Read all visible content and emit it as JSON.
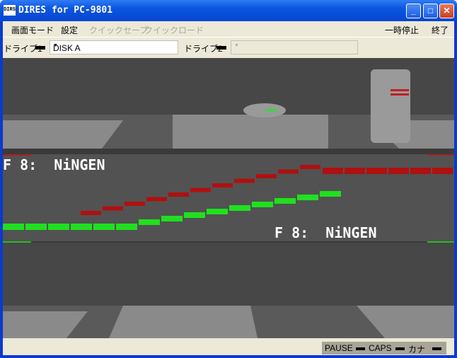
{
  "window": {
    "title": "DIRES for PC-9801",
    "icon_text": "DIRES"
  },
  "menu": {
    "items": [
      {
        "label": "画面モード",
        "enabled": true
      },
      {
        "label": "設定",
        "enabled": true
      },
      {
        "label": "クイックセーブ",
        "enabled": false
      },
      {
        "label": "クイックロード",
        "enabled": false
      }
    ],
    "pause": "一時停止",
    "exit": "終了"
  },
  "toolbar": {
    "drive1_label": "ドライブ1",
    "drive1_value": "DISK A",
    "drive2_label": "ドライブ2",
    "drive2_value": ""
  },
  "game": {
    "text_top": "F 8:  NiNGEN",
    "text_bottom": "F 8:  NiNGEN"
  },
  "status": {
    "pause": "PAUSE",
    "caps": "CAPS",
    "kana": "カナ"
  }
}
